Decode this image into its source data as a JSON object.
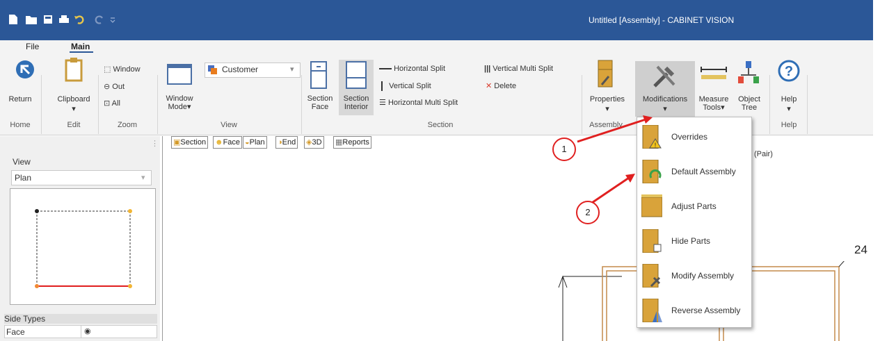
{
  "window": {
    "title": "Untitled [Assembly] - CABINET VISION"
  },
  "tabs": {
    "file": "File",
    "main": "Main"
  },
  "home": {
    "return_label": "Return",
    "group": "Home"
  },
  "edit": {
    "clipboard_label": "Clipboard",
    "group": "Edit"
  },
  "zoom": {
    "window_label": "Window",
    "out_label": "Out",
    "all_label": "All",
    "group": "Zoom"
  },
  "view": {
    "window_mode_line1": "Window",
    "window_mode_line2": "Mode▾",
    "customer_value": "Customer",
    "group": "View"
  },
  "section": {
    "face_line1": "Section",
    "face_line2": "Face",
    "interior_line1": "Section",
    "interior_line2": "Interior",
    "hsplit": "Horizontal Split",
    "vsplit": "Vertical Split",
    "hmulti": "Horizontal Multi Split",
    "vmulti": "Vertical Multi Split",
    "delete": "Delete",
    "group": "Section"
  },
  "assembly": {
    "properties": "Properties",
    "modifications": "Modifications",
    "group": "Assembly"
  },
  "tools": {
    "measure_line1": "Measure",
    "measure_line2": "Tools▾",
    "object_line1": "Object",
    "object_line2": "Tree"
  },
  "help": {
    "label": "Help",
    "group": "Help"
  },
  "leftpanel": {
    "view_label": "View",
    "view_value": "Plan",
    "side_types_label": "Side Types",
    "face_label": "Face"
  },
  "viewtabs": [
    "Section",
    "Face",
    "Plan",
    "End",
    "3D",
    "Reports"
  ],
  "canvas": {
    "pair_label": "(Pair)",
    "dimension": "24"
  },
  "menu": {
    "items": [
      "Overrides",
      "Default Assembly",
      "Adjust Parts",
      "Hide Parts",
      "Modify Assembly",
      "Reverse Assembly"
    ]
  },
  "callouts": {
    "one": "1",
    "two": "2"
  },
  "colors": {
    "titlebar": "#2b5797",
    "accent": "#2b5797",
    "callout": "#e02020",
    "cabinet": "#c48a4a"
  }
}
